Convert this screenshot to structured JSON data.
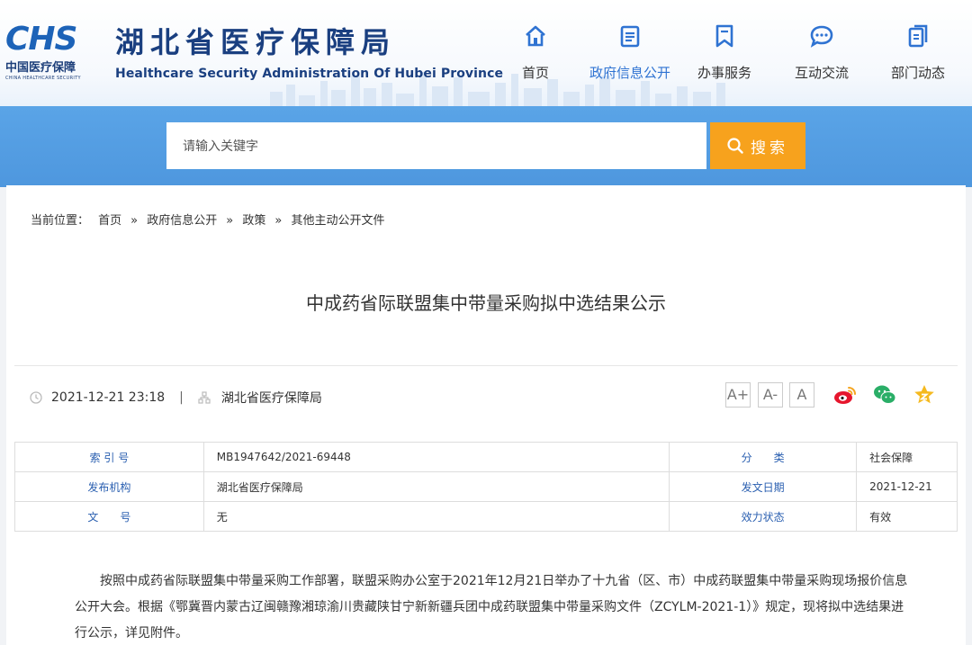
{
  "logo": {
    "mark": "CHS",
    "cn": "中国医疗保障",
    "en": "CHINA HEALTHCARE SECURITY"
  },
  "site": {
    "title_cn": "湖北省医疗保障局",
    "title_en": "Healthcare Security Administration Of Hubei Province"
  },
  "nav": [
    {
      "label": "首页",
      "icon": "home-icon"
    },
    {
      "label": "政府信息公开",
      "icon": "document-icon",
      "active": true
    },
    {
      "label": "办事服务",
      "icon": "bookmark-icon"
    },
    {
      "label": "互动交流",
      "icon": "chat-bubble-icon"
    },
    {
      "label": "部门动态",
      "icon": "pages-icon"
    }
  ],
  "search": {
    "placeholder": "请输入关键字",
    "button": "搜索"
  },
  "breadcrumb": {
    "prefix": "当前位置：",
    "items": [
      "首页",
      "政府信息公开",
      "政策",
      "其他主动公开文件"
    ],
    "separator": "»"
  },
  "article": {
    "title": "中成药省际联盟集中带量采购拟中选结果公示",
    "datetime": "2021-12-21 23:18",
    "meta_separator": "|",
    "source": "湖北省医疗保障局"
  },
  "font_controls": [
    "A+",
    "A-",
    "A"
  ],
  "share_icons": [
    "weibo-icon",
    "wechat-icon",
    "favorite-star-icon"
  ],
  "info": {
    "row1": {
      "l1": "索 引 号",
      "v1": "MB1947642/2021-69448",
      "l2": "分　　类",
      "v2": "社会保障"
    },
    "row2": {
      "l1": "发布机构",
      "v1": "湖北省医疗保障局",
      "l2": "发文日期",
      "v2": "2021-12-21"
    },
    "row3": {
      "l1": "文　　号",
      "v1": "无",
      "l2": "效力状态",
      "v2": "有效"
    }
  },
  "body": "按照中成药省际联盟集中带量采购工作部署，联盟采购办公室于2021年12月21日举办了十九省（区、市）中成药联盟集中带量采购现场报价信息公开大会。根据《鄂冀晋内蒙古辽闽赣豫湘琼渝川贵藏陕甘宁新新疆兵团中成药联盟集中带量采购文件（ZCYLM-2021-1）》规定，现将拟中选结果进行公示，详见附件。",
  "colors": {
    "brand_blue": "#1a3f80",
    "band_blue": "#5aa4e7",
    "search_orange": "#f7a21d",
    "active_nav": "#2f73d2"
  }
}
